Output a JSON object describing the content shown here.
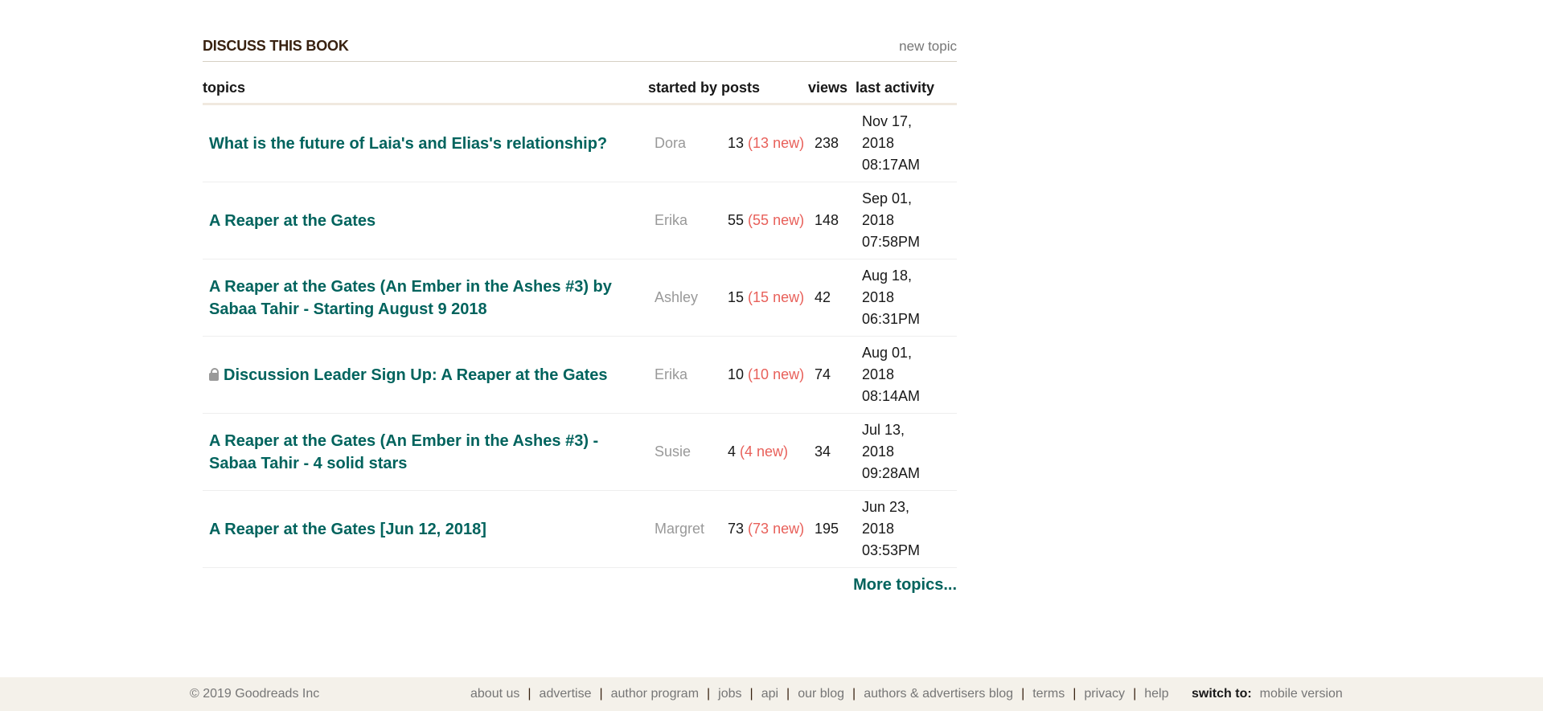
{
  "section": {
    "title": "DISCUSS THIS BOOK",
    "new_topic": "new topic"
  },
  "table": {
    "headers": {
      "topics": "topics",
      "started_by": "started by",
      "posts": "posts",
      "views": "views",
      "last_activity": "last activity"
    },
    "rows": [
      {
        "title": "What is the future of Laia's and Elias's relationship?",
        "author": "Dora",
        "posts": "13",
        "new": "(13 new)",
        "views": "238",
        "date": "Nov 17,",
        "year": "2018",
        "time": "08:17AM",
        "locked": false
      },
      {
        "title": "A Reaper at the Gates",
        "author": "Erika",
        "posts": "55",
        "new": "(55 new)",
        "views": "148",
        "date": "Sep 01,",
        "year": "2018",
        "time": "07:58PM",
        "locked": false
      },
      {
        "title": "A Reaper at the Gates (An Ember in the Ashes #3) by Sabaa Tahir - Starting August 9 2018",
        "author": "Ashley",
        "posts": "15",
        "new": "(15 new)",
        "views": "42",
        "date": "Aug 18,",
        "year": "2018",
        "time": "06:31PM",
        "locked": false
      },
      {
        "title": "Discussion Leader Sign Up: A Reaper at the Gates",
        "author": "Erika",
        "posts": "10",
        "new": "(10 new)",
        "views": "74",
        "date": "Aug 01,",
        "year": "2018",
        "time": "08:14AM",
        "locked": true
      },
      {
        "title": "A Reaper at the Gates (An Ember in the Ashes #3) - Sabaa Tahir - 4 solid stars",
        "author": "Susie",
        "posts": "4",
        "new": "(4 new)",
        "views": "34",
        "date": "Jul 13,",
        "year": "2018",
        "time": "09:28AM",
        "locked": false
      },
      {
        "title": "A Reaper at the Gates [Jun 12, 2018]",
        "author": "Margret",
        "posts": "73",
        "new": "(73 new)",
        "views": "195",
        "date": "Jun 23,",
        "year": "2018",
        "time": "03:53PM",
        "locked": false
      }
    ]
  },
  "more_topics": "More topics...",
  "footer": {
    "copyright": "© 2019 Goodreads Inc",
    "links": [
      "about us",
      "advertise",
      "author program",
      "jobs",
      "api",
      "our blog",
      "authors & advertisers blog",
      "terms",
      "privacy",
      "help"
    ],
    "switch_label": "switch to:",
    "mobile_version": "mobile version"
  },
  "colors": {
    "link": "#00635d",
    "new_count": "#e8605a",
    "muted": "#999999",
    "footer_bg": "#f4f1ea"
  }
}
